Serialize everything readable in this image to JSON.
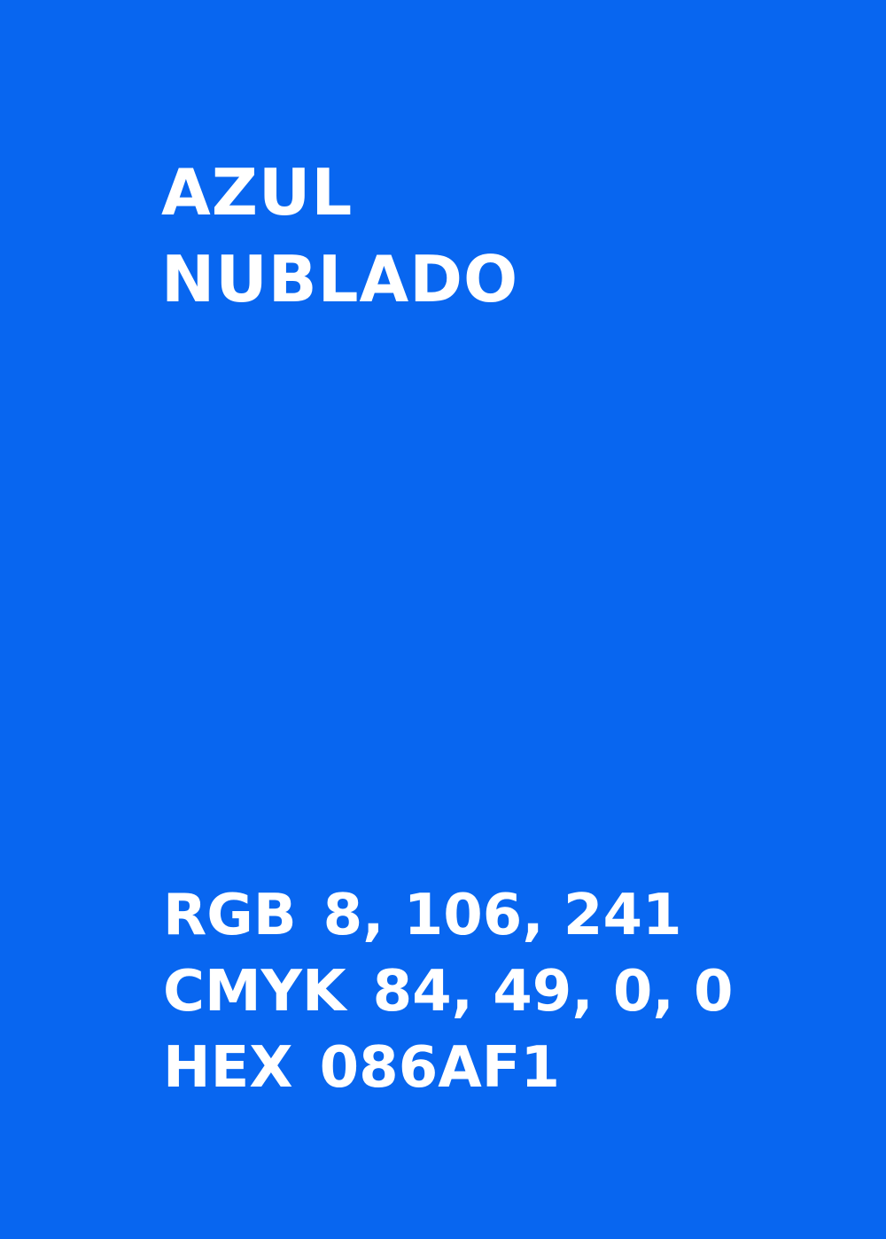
{
  "swatch": {
    "background_color": "#0866F0",
    "text_color": "#FFFFFF",
    "title_line_1": "AZUL",
    "title_line_2": "NUBLADO",
    "specs": [
      {
        "label": "RGB",
        "value": "8, 106, 241"
      },
      {
        "label": "CMYK",
        "value": "84, 49, 0, 0"
      },
      {
        "label": "HEX",
        "value": "086AF1"
      }
    ]
  }
}
